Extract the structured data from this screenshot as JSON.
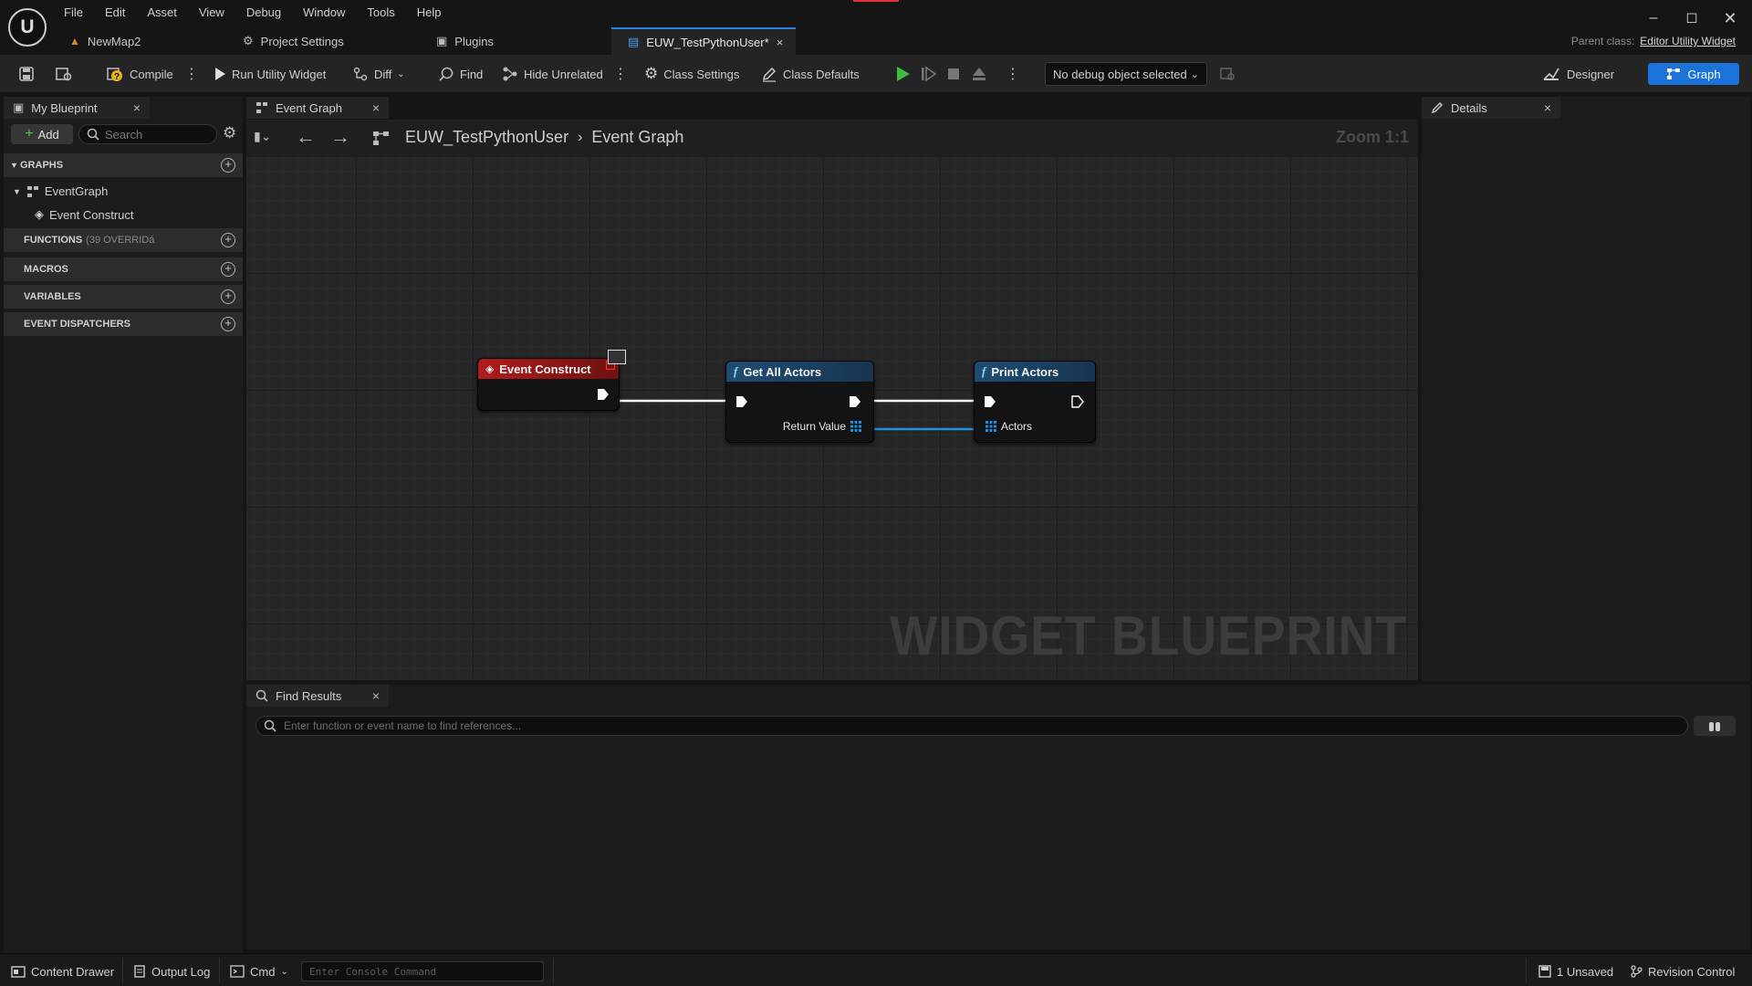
{
  "app": {
    "menu": [
      "File",
      "Edit",
      "Asset",
      "View",
      "Debug",
      "Window",
      "Tools",
      "Help"
    ],
    "doc_tabs": [
      {
        "label": "NewMap2",
        "icon": "level-icon"
      },
      {
        "label": "Project Settings",
        "icon": "settings-icon"
      },
      {
        "label": "Plugins",
        "icon": "plugin-icon"
      },
      {
        "label": "EUW_TestPythonUser*",
        "icon": "blueprint-icon",
        "active": true
      }
    ],
    "parent_class_label": "Parent class:",
    "parent_class_value": "Editor Utility Widget"
  },
  "toolbar": {
    "compile": "Compile",
    "run": "Run Utility Widget",
    "diff": "Diff",
    "find": "Find",
    "hide_unrelated": "Hide Unrelated",
    "class_settings": "Class Settings",
    "class_defaults": "Class Defaults",
    "debug_object": "No debug object selected",
    "designer": "Designer",
    "graph": "Graph"
  },
  "left_panel": {
    "tab": "My Blueprint",
    "add": "Add",
    "search_placeholder": "Search",
    "sections": {
      "graphs": "GRAPHS",
      "functions": "FUNCTIONS",
      "functions_note": "(39 OVERRIDá",
      "macros": "MACROS",
      "variables": "VARIABLES",
      "dispatchers": "EVENT DISPATCHERS"
    },
    "tree": {
      "event_graph": "EventGraph",
      "event_construct": "Event Construct"
    }
  },
  "graph": {
    "tab": "Event Graph",
    "breadcrumb_root": "EUW_TestPythonUser",
    "breadcrumb_leaf": "Event Graph",
    "zoom": "Zoom 1:1",
    "watermark": "WIDGET BLUEPRINT",
    "nodes": {
      "event_construct": "Event Construct",
      "get_all_actors": "Get All Actors",
      "get_all_actors_out": "Return Value",
      "print_actors": "Print Actors",
      "print_actors_in": "Actors"
    },
    "colors": {
      "event_header": "#b01c1c",
      "function_header": "#1f4d72",
      "exec_wire": "#ffffff",
      "array_wire": "#1e8fe0"
    }
  },
  "details": {
    "tab": "Details"
  },
  "find_results": {
    "tab": "Find Results",
    "placeholder": "Enter function or event name to find references..."
  },
  "statusbar": {
    "content_drawer": "Content Drawer",
    "output_log": "Output Log",
    "cmd": "Cmd",
    "console_placeholder": "Enter Console Command",
    "unsaved": "1 Unsaved",
    "revision_control": "Revision Control"
  }
}
